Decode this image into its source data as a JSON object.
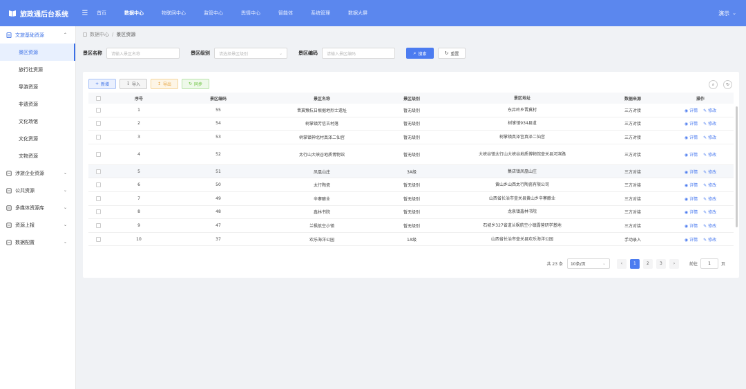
{
  "header": {
    "title": "旅政通后台系统",
    "nav": [
      "首页",
      "数据中心",
      "物联网中心",
      "监管中心",
      "舆情中心",
      "智能体",
      "系统管理",
      "数据大屏"
    ],
    "active_nav": "数据中心",
    "user": "演示"
  },
  "sidebar": {
    "group_open": "文旅基础资源",
    "sub_items": [
      "景区资源",
      "旅行社资源",
      "导游资源",
      "非遗资源",
      "文化场馆",
      "文化资源",
      "文物资源"
    ],
    "active_sub": "景区资源",
    "groups": [
      "涉旅企业资源",
      "公共资源",
      "多媒体资源库",
      "资源上报",
      "数据配置"
    ]
  },
  "breadcrumb": {
    "root": "数据中心",
    "current": "景区资源"
  },
  "search": {
    "name_label": "景区名称",
    "name_placeholder": "请输入景区名称",
    "level_label": "景区级别",
    "level_placeholder": "请选择景区级别",
    "code_label": "景区编码",
    "code_placeholder": "请输入景区编码",
    "search_btn": "搜索",
    "reset_btn": "重置"
  },
  "toolbar": {
    "add": "新增",
    "import": "导入",
    "export": "导出",
    "sync": "同步"
  },
  "table": {
    "columns": {
      "seq": "序号",
      "code": "景区编码",
      "name": "景区名称",
      "level": "景区级别",
      "addr": "景区地址",
      "source": "数据来源",
      "ops": "操作"
    },
    "op_detail": "详情",
    "op_edit": "修改",
    "rows": [
      {
        "seq": "1",
        "code": "55",
        "name": "晋冀豫抗日根据地烈士遗址",
        "level": "暂无级别",
        "addr": "东井岭乡晋冀村",
        "source": "三方对接"
      },
      {
        "seq": "2",
        "code": "54",
        "name": "树掌镇芳信古村落",
        "level": "暂无级别",
        "addr": "树掌镇934县道",
        "source": "三方对接"
      },
      {
        "seq": "3",
        "code": "53",
        "name": "树掌镇神北村真泽二仙宫",
        "level": "暂无级别",
        "addr": "树掌镇真泽宫真泽二仙宫",
        "source": "三方对接"
      },
      {
        "seq": "4",
        "code": "52",
        "name": "太行山大峡谷地质博物馆",
        "level": "暂无级别",
        "addr": "大峡谷镇太行山大峡谷地质博物馆壶关县河滨路",
        "source": "三方对接"
      },
      {
        "seq": "5",
        "code": "51",
        "name": "凤凰山庄",
        "level": "3A级",
        "addr": "集店镇凤凰山庄",
        "source": "三方对接"
      },
      {
        "seq": "6",
        "code": "50",
        "name": "太行陶瓷",
        "level": "暂无级别",
        "addr": "黄山乡山西太行陶瓷有限公司",
        "source": "三方对接"
      },
      {
        "seq": "7",
        "code": "49",
        "name": "辛寨酿业",
        "level": "暂无级别",
        "addr": "山西省长治市壶关县黄山乡辛寨酿业",
        "source": "三方对接"
      },
      {
        "seq": "8",
        "code": "48",
        "name": "鑫林书院",
        "level": "暂无级别",
        "addr": "龙泉镇鑫林书院",
        "source": "三方对接"
      },
      {
        "seq": "9",
        "code": "47",
        "name": "兰枫航空小镇",
        "level": "暂无级别",
        "addr": "石坡乡327省道兰枫航空小镇露营研学基地",
        "source": "三方对接"
      },
      {
        "seq": "10",
        "code": "37",
        "name": "欢乐海洋公园",
        "level": "1A级",
        "addr": "山西省长治市壶关县欢乐海洋公园",
        "source": "手动录入"
      }
    ]
  },
  "pager": {
    "total": "共 23 条",
    "size": "10条/页",
    "pages": [
      "1",
      "2",
      "3"
    ],
    "current": "1",
    "goto_label": "前往",
    "goto_value": "1",
    "page_unit": "页"
  }
}
